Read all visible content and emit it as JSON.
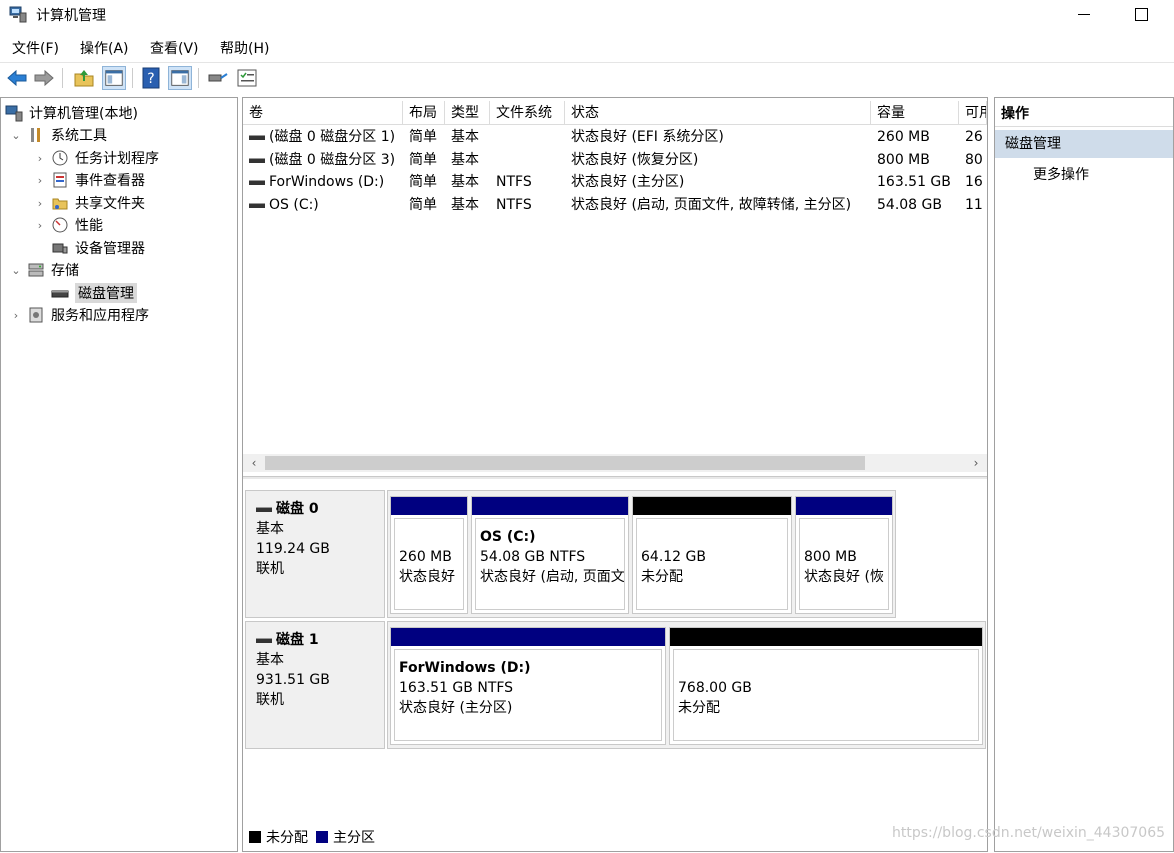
{
  "window": {
    "title": "计算机管理"
  },
  "menu": [
    "文件(F)",
    "操作(A)",
    "查看(V)",
    "帮助(H)"
  ],
  "toolbar": {
    "icons": [
      "back-arrow-icon",
      "forward-arrow-icon",
      "up-folder-icon",
      "show-hide-tree-icon",
      "help-icon",
      "show-hide-action-pane-icon",
      "connect-icon",
      "properties-icon"
    ]
  },
  "tree": {
    "root": "计算机管理(本地)",
    "system_tools": "系统工具",
    "task_scheduler": "任务计划程序",
    "event_viewer": "事件查看器",
    "shared_folders": "共享文件夹",
    "performance": "性能",
    "device_manager": "设备管理器",
    "storage": "存储",
    "disk_management": "磁盘管理",
    "services_apps": "服务和应用程序"
  },
  "volumes": {
    "columns": [
      "卷",
      "布局",
      "类型",
      "文件系统",
      "状态",
      "容量",
      "可用"
    ],
    "rows": [
      {
        "volume": "(磁盘 0 磁盘分区 1)",
        "layout": "简单",
        "type": "基本",
        "fs": "",
        "status": "状态良好 (EFI 系统分区)",
        "capacity": "260 MB",
        "free": "26"
      },
      {
        "volume": "(磁盘 0 磁盘分区 3)",
        "layout": "简单",
        "type": "基本",
        "fs": "",
        "status": "状态良好 (恢复分区)",
        "capacity": "800 MB",
        "free": "80"
      },
      {
        "volume": "ForWindows (D:)",
        "layout": "简单",
        "type": "基本",
        "fs": "NTFS",
        "status": "状态良好 (主分区)",
        "capacity": "163.51 GB",
        "free": "16"
      },
      {
        "volume": "OS (C:)",
        "layout": "简单",
        "type": "基本",
        "fs": "NTFS",
        "status": "状态良好 (启动, 页面文件, 故障转储, 主分区)",
        "capacity": "54.08 GB",
        "free": "11"
      }
    ]
  },
  "disks": [
    {
      "name": "磁盘 0",
      "type": "基本",
      "size": "119.24 GB",
      "state": "联机",
      "partitions": [
        {
          "name": "",
          "line1": "260 MB",
          "line2": "状态良好",
          "kind": "primary"
        },
        {
          "name": "OS  (C:)",
          "line1": "54.08 GB NTFS",
          "line2": "状态良好 (启动, 页面文",
          "kind": "primary"
        },
        {
          "name": "",
          "line1": "64.12 GB",
          "line2": "未分配",
          "kind": "unalloc"
        },
        {
          "name": "",
          "line1": "800 MB",
          "line2": "状态良好 (恢",
          "kind": "primary"
        }
      ]
    },
    {
      "name": "磁盘 1",
      "type": "基本",
      "size": "931.51 GB",
      "state": "联机",
      "partitions": [
        {
          "name": "ForWindows  (D:)",
          "line1": "163.51 GB NTFS",
          "line2": "状态良好 (主分区)",
          "kind": "primary"
        },
        {
          "name": "",
          "line1": "768.00 GB",
          "line2": "未分配",
          "kind": "unalloc"
        }
      ]
    }
  ],
  "legend": {
    "unallocated": "未分配",
    "primary": "主分区"
  },
  "actions": {
    "header": "操作",
    "section": "磁盘管理",
    "more": "更多操作"
  },
  "colors": {
    "primary_partition": "#000080",
    "unallocated": "#000000",
    "selection": "#cfdcea"
  },
  "watermark": "https://blog.csdn.net/weixin_44307065"
}
